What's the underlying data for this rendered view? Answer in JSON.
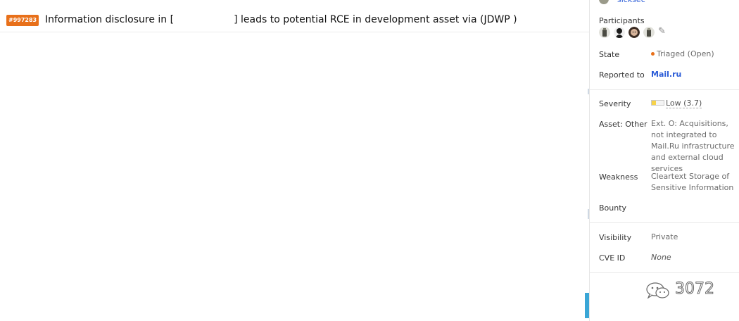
{
  "report": {
    "id": "#997283",
    "title_part1": "Information disclosure in [",
    "title_part2": "] leads to potential RCE in development asset via (JDWP )"
  },
  "sidebar": {
    "reporter": "sicksec",
    "participants_label": "Participants",
    "state": {
      "label": "State",
      "value": "Triaged (Open)",
      "color": "#e8701a"
    },
    "reported_to": {
      "label": "Reported to",
      "value": "Mail.ru"
    },
    "severity": {
      "label": "Severity",
      "value": "Low (3.7)",
      "level": 0.37
    },
    "asset": {
      "label": "Asset: Other",
      "value": "Ext. O: Acquisitions, not integrated to Mail.Ru infrastructure and external cloud services"
    },
    "weakness": {
      "label": "Weakness",
      "value": "Cleartext Storage of Sensitive Information"
    },
    "bounty": {
      "label": "Bounty"
    },
    "visibility": {
      "label": "Visibility",
      "value": "Private"
    },
    "cve": {
      "label": "CVE ID",
      "value": "None"
    }
  },
  "watermark": {
    "text": "3072"
  },
  "colors": {
    "accent": "#e8701a",
    "link": "#2a5bd7"
  }
}
